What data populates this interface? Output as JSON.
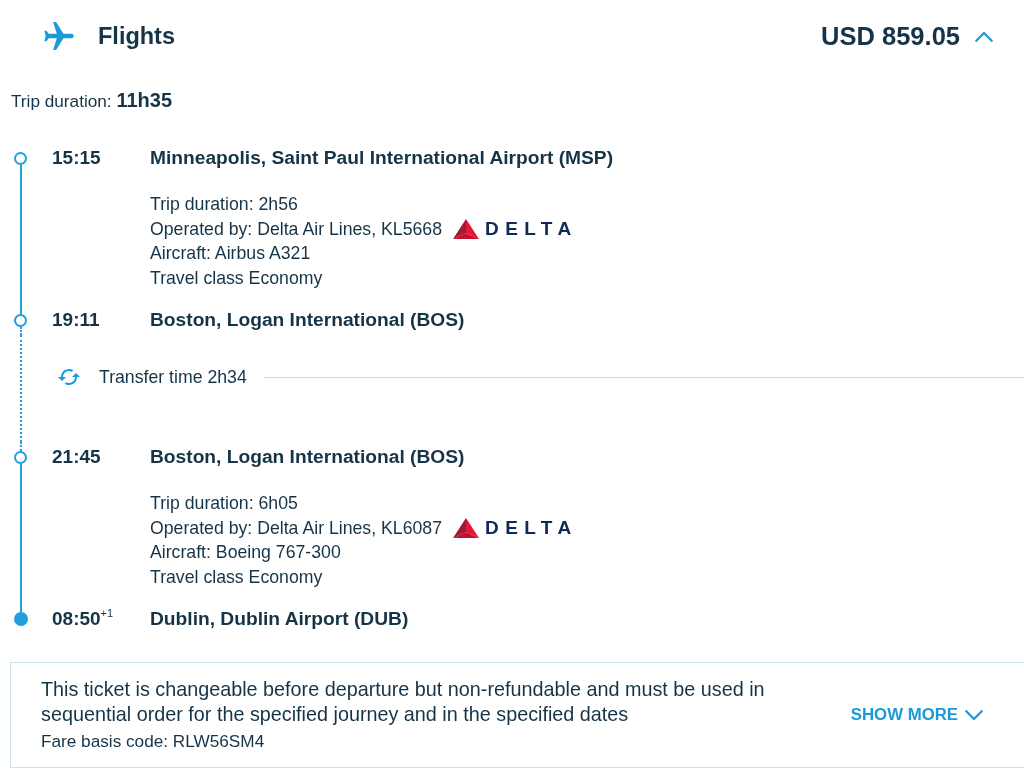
{
  "header": {
    "title": "Flights",
    "price": "USD 859.05",
    "expanded": true
  },
  "trip_duration": "Trip duration: **11h35**",
  "itinerary": [
    {
      "kind": "stop",
      "time": "15:15",
      "place": "Minneapolis, Saint Paul International Airport (MSP)",
      "filled": false
    },
    {
      "kind": "leg",
      "duration": "Trip duration: 2h56",
      "operator": "Operated by: Delta Air Lines, KL5668",
      "logo_text": "DELTA",
      "aircraft": "Aircraft: Airbus A321",
      "travel_class": "Travel class Economy"
    },
    {
      "kind": "stop",
      "time": "19:11",
      "place": "Boston, Logan International (BOS)",
      "filled": false
    },
    {
      "kind": "transfer",
      "label": "Transfer time 2h34"
    },
    {
      "kind": "stop",
      "time": "21:45",
      "place": "Boston, Logan International (BOS)",
      "filled": false
    },
    {
      "kind": "leg",
      "duration": "Trip duration: 6h05",
      "operator": "Operated by: Delta Air Lines, KL6087",
      "logo_text": "DELTA",
      "aircraft": "Aircraft: Boeing 767-300",
      "travel_class": "Travel class Economy"
    },
    {
      "kind": "stop",
      "time": "08:50$^{+1}$",
      "place": "Dublin, Dublin Airport (DUB)",
      "filled": true
    }
  ],
  "fare_note": {
    "text": "This ticket is changeable before departure but non-refundable and must be used in sequential order for the specified journey and in the specified dates",
    "fare_basis": "Fare basis code: RLW56SM4",
    "show_more": {
      "label": "SHOW MORE",
      "expanded": false
    }
  }
}
